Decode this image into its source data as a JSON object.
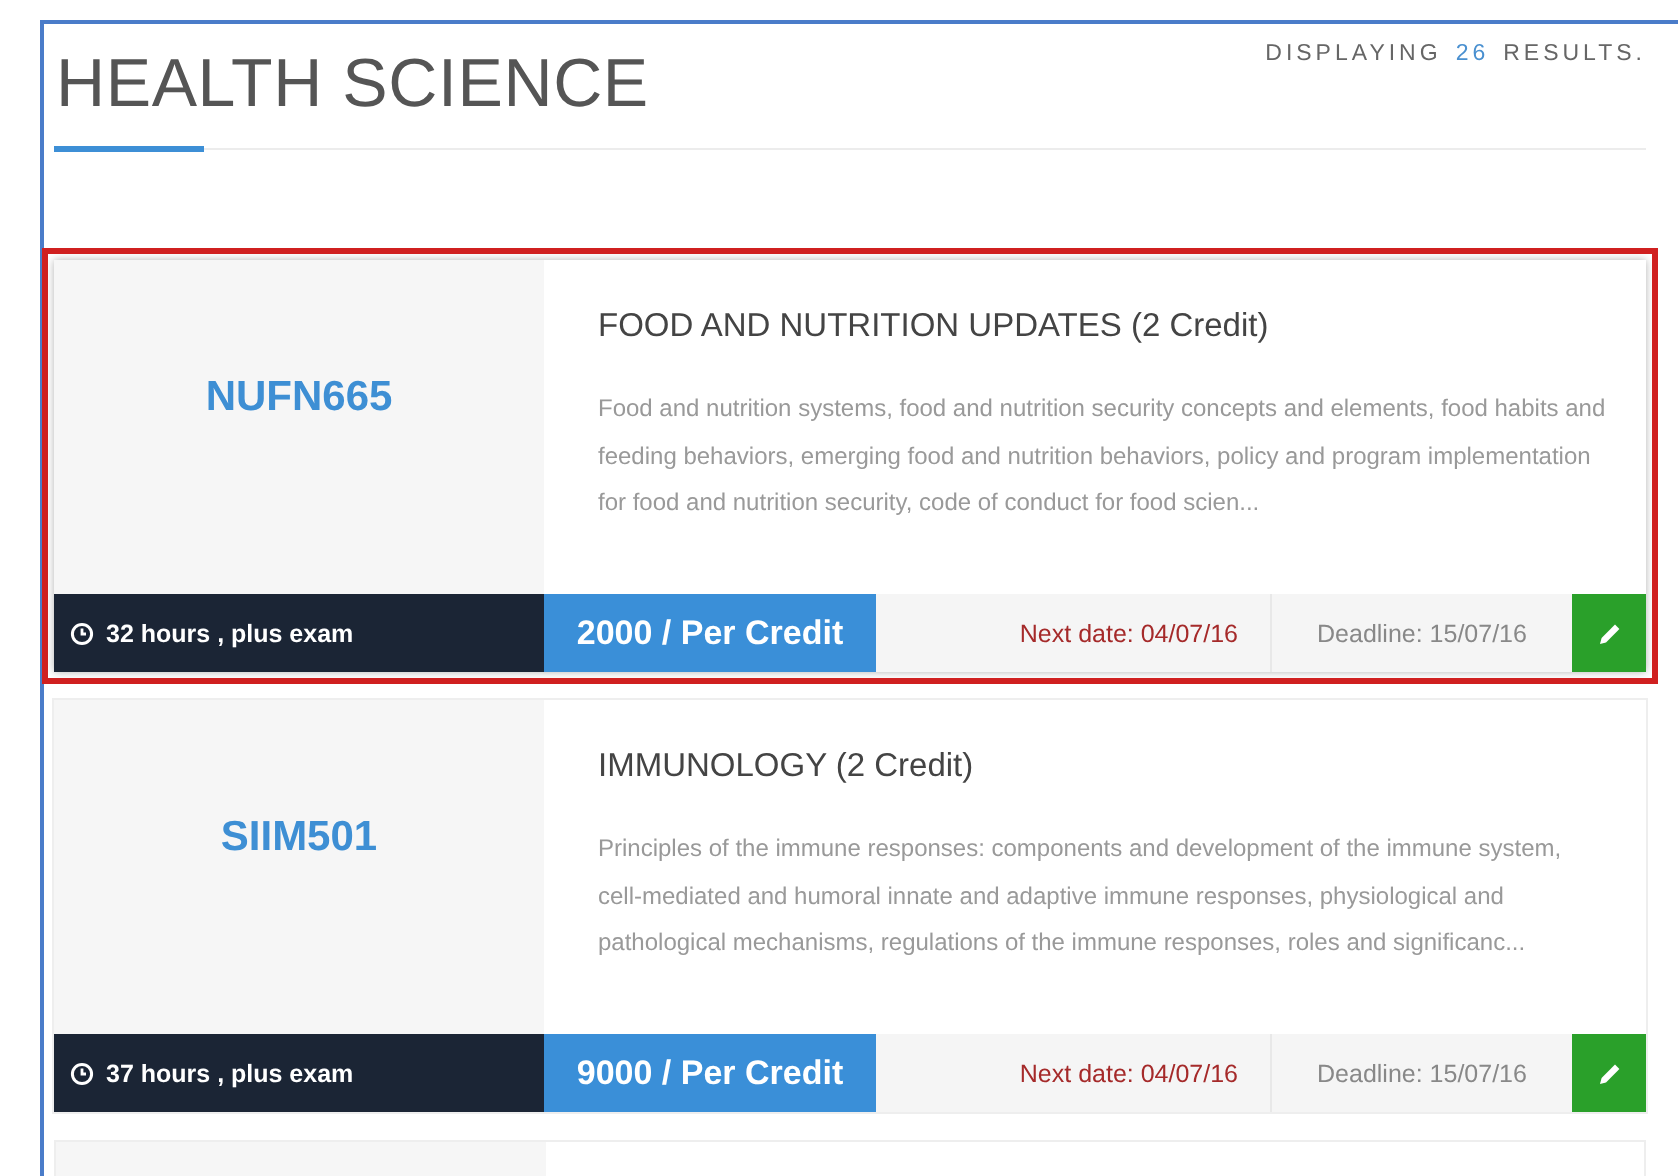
{
  "heading": {
    "title": "HEALTH SCIENCE",
    "results": {
      "prefix": "DISPLAYING",
      "count": "26",
      "suffix": "RESULTS."
    }
  },
  "courses": [
    {
      "code": "NUFN665",
      "title": "FOOD AND NUTRITION UPDATES (2 Credit)",
      "description": "Food and nutrition systems, food and nutrition security concepts and elements, food habits and feeding behaviors, emerging food and nutrition behaviors, policy and program implementation for food and nutrition security, code of conduct for food scien...",
      "duration": "32 hours , plus exam",
      "price": "2000 / Per Credit",
      "next_date": "Next date: 04/07/16",
      "deadline": "Deadline: 15/07/16",
      "highlighted": true
    },
    {
      "code": "SIIM501",
      "title": "IMMUNOLOGY (2 Credit)",
      "description": "Principles of the immune responses: components and development of the immune system, cell-mediated and humoral innate and adaptive immune responses, physiological and pathological mechanisms, regulations of the immune responses, roles and significanc...",
      "duration": "37 hours , plus exam",
      "price": "9000 / Per Credit",
      "next_date": "Next date: 04/07/16",
      "deadline": "Deadline: 15/07/16",
      "highlighted": false
    }
  ]
}
